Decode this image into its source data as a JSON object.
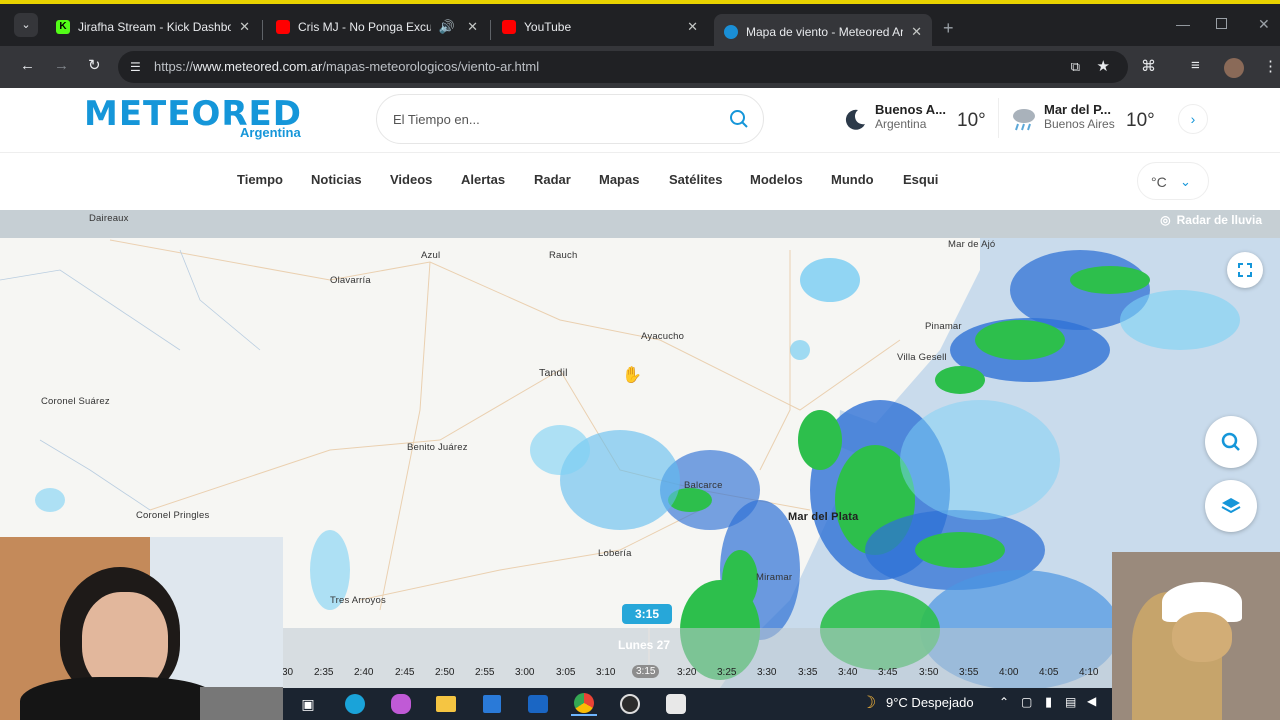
{
  "browser": {
    "tabs": [
      {
        "title": "Jirafha Stream - Kick Dashboard",
        "favicon_color": "#53fc18"
      },
      {
        "title": "Cris MJ - No Ponga Excusas",
        "favicon_color": "#ff0000"
      },
      {
        "title": "YouTube",
        "favicon_color": "#ff0000"
      },
      {
        "title": "Mapa de viento - Meteored Argentina",
        "favicon_color": "#1a8fd6"
      }
    ],
    "url_prefix": "https://",
    "url_host": "www.meteored.com.ar",
    "url_path": "/mapas-meteorologicos/viento-ar.html"
  },
  "site": {
    "logo": "METEORED",
    "logo_sub": "Argentina",
    "search_placeholder": "El Tiempo en...",
    "weather": [
      {
        "city": "Buenos A...",
        "region": "Argentina",
        "temp": "10°"
      },
      {
        "city": "Mar del P...",
        "region": "Buenos Aires",
        "temp": "10°"
      }
    ],
    "nav": [
      "Tiempo",
      "Noticias",
      "Videos",
      "Alertas",
      "Radar",
      "Mapas",
      "Satélites",
      "Modelos",
      "Mundo",
      "Esqui"
    ],
    "unit": "°C"
  },
  "map": {
    "layer_label": "Radar de lluvia",
    "places": [
      {
        "name": "Daireaux"
      },
      {
        "name": "Azul"
      },
      {
        "name": "Rauch"
      },
      {
        "name": "Olavarría"
      },
      {
        "name": "Mar de Ajó"
      },
      {
        "name": "Ayacucho"
      },
      {
        "name": "Pinamar"
      },
      {
        "name": "Villa Gesell"
      },
      {
        "name": "Tandil"
      },
      {
        "name": "Coronel Suárez"
      },
      {
        "name": "Benito Juárez"
      },
      {
        "name": "Balcarce"
      },
      {
        "name": "Mar del Plata"
      },
      {
        "name": "Coronel Pringles"
      },
      {
        "name": "Lobería"
      },
      {
        "name": "Miramar"
      },
      {
        "name": "Tres Arroyos"
      }
    ]
  },
  "timeline": {
    "current": "3:15",
    "day": "Lunes 27",
    "ticks": [
      "30",
      "2:35",
      "2:40",
      "2:45",
      "2:50",
      "2:55",
      "3:00",
      "3:05",
      "3:10",
      "3:15",
      "3:20",
      "3:25",
      "3:30",
      "3:35",
      "3:40",
      "3:45",
      "3:50",
      "3:55",
      "4:00",
      "4:05",
      "4:10"
    ]
  },
  "taskbar": {
    "weather": "9°C  Despejado"
  }
}
